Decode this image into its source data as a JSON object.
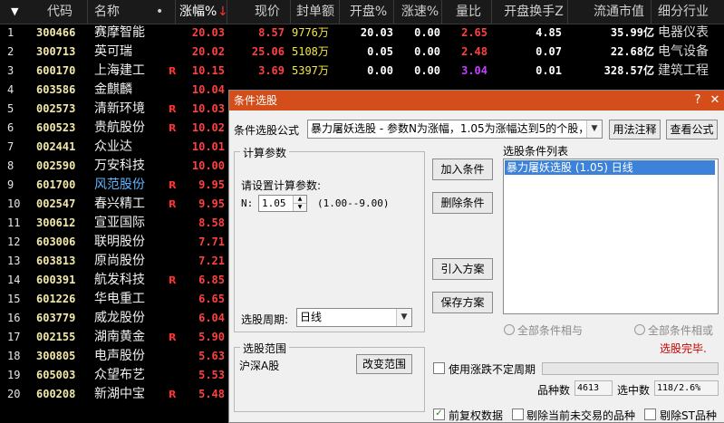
{
  "table": {
    "headers": {
      "idx": "▼",
      "code": "代码",
      "name": "名称",
      "dot": "•",
      "chg": "涨幅%",
      "chg_arrow": "↓",
      "price": "现价",
      "seal": "封单额",
      "open": "开盘%",
      "speed": "涨速%",
      "vr": "量比",
      "turnover": "开盘换手Z",
      "mcap": "流通市值",
      "industry": "细分行业"
    },
    "rows": [
      {
        "i": "1",
        "code": "300466",
        "name": "赛摩智能",
        "r": "",
        "chg": "20.03",
        "price": "8.57",
        "seal": "9776万",
        "open": "20.03",
        "speed": "0.00",
        "vr": "2.65",
        "turn": "4.85",
        "mcap": "35.99亿",
        "ind": "电器仪表",
        "vr_color": "#ff4040",
        "name_color": "#f0f0f0"
      },
      {
        "i": "2",
        "code": "300713",
        "name": "英可瑞",
        "r": "",
        "chg": "20.02",
        "price": "25.06",
        "seal": "5108万",
        "open": "0.05",
        "speed": "0.00",
        "vr": "2.48",
        "turn": "0.07",
        "mcap": "22.68亿",
        "ind": "电气设备",
        "vr_color": "#ff4040",
        "name_color": "#f0f0f0"
      },
      {
        "i": "3",
        "code": "600170",
        "name": "上海建工",
        "r": "R",
        "chg": "10.15",
        "price": "3.69",
        "seal": "5397万",
        "open": "0.00",
        "speed": "0.00",
        "vr": "3.04",
        "turn": "0.01",
        "mcap": "328.57亿",
        "ind": "建筑工程",
        "vr_color": "#c040ff",
        "name_color": "#f0f0f0"
      },
      {
        "i": "4",
        "code": "603586",
        "name": "金麒麟",
        "r": "",
        "chg": "10.04",
        "price": "",
        "seal": "",
        "open": "",
        "speed": "",
        "vr": "",
        "turn": "",
        "mcap": "",
        "ind": "",
        "vr_color": "#ff4040",
        "name_color": "#f0f0f0"
      },
      {
        "i": "5",
        "code": "002573",
        "name": "清新环境",
        "r": "R",
        "chg": "10.03",
        "name_color": "#f0f0f0"
      },
      {
        "i": "6",
        "code": "600523",
        "name": "贵航股份",
        "r": "R",
        "chg": "10.02",
        "name_color": "#f0f0f0"
      },
      {
        "i": "7",
        "code": "002441",
        "name": "众业达",
        "r": "",
        "chg": "10.01",
        "name_color": "#f0f0f0"
      },
      {
        "i": "8",
        "code": "002590",
        "name": "万安科技",
        "r": "",
        "chg": "10.00",
        "name_color": "#f0f0f0"
      },
      {
        "i": "9",
        "code": "601700",
        "name": "风范股份",
        "r": "R",
        "chg": "9.95",
        "name_color": "#5fb4ff"
      },
      {
        "i": "10",
        "code": "002547",
        "name": "春兴精工",
        "r": "R",
        "chg": "9.95",
        "name_color": "#f0f0f0"
      },
      {
        "i": "11",
        "code": "300612",
        "name": "宣亚国际",
        "r": "",
        "chg": "8.58",
        "name_color": "#f0f0f0"
      },
      {
        "i": "12",
        "code": "603006",
        "name": "联明股份",
        "r": "",
        "chg": "7.71",
        "name_color": "#f0f0f0"
      },
      {
        "i": "13",
        "code": "603813",
        "name": "原尚股份",
        "r": "",
        "chg": "7.21",
        "name_color": "#f0f0f0"
      },
      {
        "i": "14",
        "code": "600391",
        "name": "航发科技",
        "r": "R",
        "chg": "6.85",
        "name_color": "#f0f0f0"
      },
      {
        "i": "15",
        "code": "601226",
        "name": "华电重工",
        "r": "",
        "chg": "6.65",
        "name_color": "#f0f0f0"
      },
      {
        "i": "16",
        "code": "603779",
        "name": "威龙股份",
        "r": "",
        "chg": "6.04",
        "name_color": "#f0f0f0"
      },
      {
        "i": "17",
        "code": "002155",
        "name": "湖南黄金",
        "r": "R",
        "chg": "5.90",
        "name_color": "#f0f0f0"
      },
      {
        "i": "18",
        "code": "300805",
        "name": "电声股份",
        "r": "",
        "chg": "5.63",
        "name_color": "#f0f0f0"
      },
      {
        "i": "19",
        "code": "605003",
        "name": "众望布艺",
        "r": "",
        "chg": "5.53",
        "name_color": "#f0f0f0"
      },
      {
        "i": "20",
        "code": "600208",
        "name": "新湖中宝",
        "r": "R",
        "chg": "5.48",
        "name_color": "#f0f0f0"
      }
    ]
  },
  "dialog": {
    "title": "条件选股",
    "help_icon": "?",
    "close_icon": "✕",
    "formula_label": "条件选股公式",
    "formula_value": "暴力屠妖选股 - 参数N为涨幅，1.05为涨幅达到5的个股，",
    "usage_button": "用法注释",
    "view_formula_button": "查看公式",
    "calc_group": "计算参数",
    "calc_prompt": "请设置计算参数:",
    "param_label": "N:",
    "param_value": "1.05",
    "param_range": "(1.00--9.00)",
    "add_button": "加入条件",
    "delete_button": "删除条件",
    "import_button": "引入方案",
    "save_button": "保存方案",
    "cond_list_label": "选股条件列表",
    "cond_items": [
      "暴力屠妖选股 (1.05) 日线"
    ],
    "period_label": "选股周期:",
    "period_value": "日线",
    "radio_and": "全部条件相与",
    "radio_or": "全部条件相或",
    "status": "选股完毕.",
    "range_group": "选股范围",
    "range_value": "沪深A股",
    "change_range_button": "改变范围",
    "indeterminate_label": "使用涨跌不定周期",
    "count_label": "品种数",
    "count_value": "4613",
    "selected_label": "选中数",
    "selected_value": "118/2.6%",
    "forward_adjust_label": "前复权数据",
    "exclude_untraded_label": "剔除当前未交易的品种",
    "exclude_st_label": "剔除ST品种"
  },
  "colors": {
    "title_bar": "#d44e1c",
    "status": "#cc0000",
    "list_selected": "#3b82d8"
  }
}
